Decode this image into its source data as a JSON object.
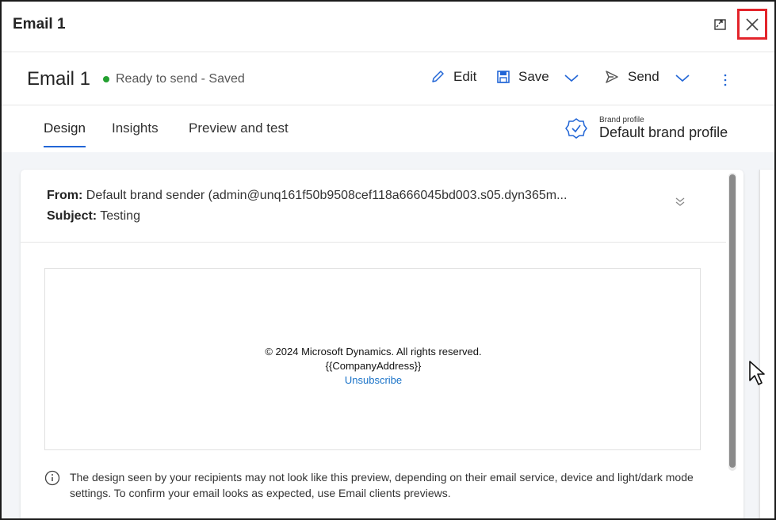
{
  "dialog": {
    "title": "Email 1",
    "icons": {
      "expand": "expand-icon",
      "close": "close-icon"
    }
  },
  "command_bar": {
    "doc_title": "Email 1",
    "status": "Ready to send - Saved",
    "status_color": "#23a030",
    "edit_label": "Edit",
    "save_label": "Save",
    "send_label": "Send",
    "icons": {
      "edit": "pencil-icon",
      "save": "floppy-disk-icon",
      "send": "send-icon",
      "more": "more-vertical-icon"
    },
    "accent": "#2266d6"
  },
  "tabs": [
    {
      "label": "Design",
      "active": true
    },
    {
      "label": "Insights",
      "active": false
    },
    {
      "label": "Preview and test",
      "active": false
    }
  ],
  "brand_profile": {
    "caption": "Brand profile",
    "value": "Default brand profile",
    "icon": "badge-check-icon"
  },
  "email_preview": {
    "from_label": "From:",
    "from_value": "Default brand sender (admin@unq161f50b9508cef118a666045bd003.s05.dyn365m...",
    "subject_label": "Subject:",
    "subject_value": "Testing",
    "footer_copyright": "© 2024 Microsoft Dynamics. All rights reserved.",
    "footer_address": "{{CompanyAddress}}",
    "unsubscribe_label": "Unsubscribe",
    "unsubscribe_color": "#1a73c8",
    "info_note": "The design seen by your recipients may not look like this preview, depending on their email service, device and light/dark mode settings. To confirm your email looks as expected, use Email clients previews."
  }
}
